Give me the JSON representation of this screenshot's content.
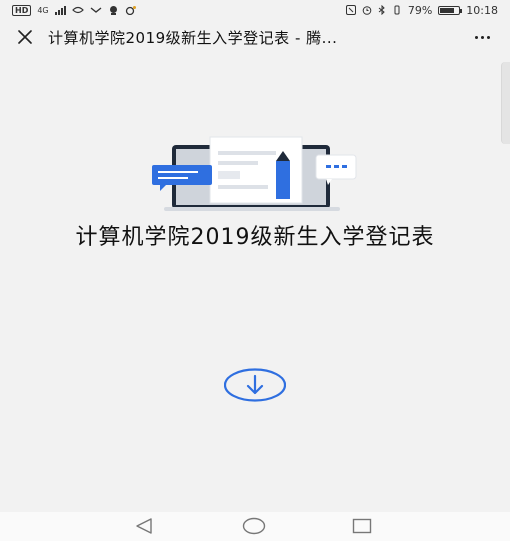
{
  "status_bar": {
    "network_label": "HD",
    "signal_label": "4G",
    "battery_percent": "79%",
    "battery_level": 0.79,
    "time": "10:18"
  },
  "title_bar": {
    "title": "计算机学院2019级新生入学登记表 - 腾..."
  },
  "document": {
    "title": "计算机学院2019级新生入学登记表"
  },
  "colors": {
    "accent_blue": "#2f6fe0",
    "background": "#f2f2f2",
    "text": "#111111"
  },
  "icons": {
    "close": "close-icon",
    "more": "more-icon",
    "download": "download-icon",
    "back": "back-icon",
    "home": "home-icon",
    "recents": "recents-icon"
  }
}
